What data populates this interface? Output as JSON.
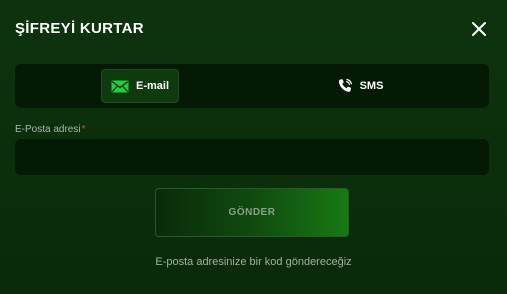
{
  "dialog": {
    "title": "ŞİFREYİ KURTAR",
    "close_icon": "close-icon"
  },
  "tabs": [
    {
      "label": "E-mail",
      "icon": "envelope-icon",
      "selected": true
    },
    {
      "label": "SMS",
      "icon": "phone-icon",
      "selected": false
    }
  ],
  "form": {
    "email_label": "E-Posta adresi",
    "required_mark": "*",
    "email_value": "",
    "email_placeholder": "",
    "submit_label": "GÖNDER",
    "hint": "E-posta adresinize bir kod göndereceğiz"
  },
  "colors": {
    "background": "#0b2e0b",
    "field_background": "#041a04",
    "accent": "#187a14",
    "required": "#e0453a",
    "envelope": "#27c93f"
  }
}
